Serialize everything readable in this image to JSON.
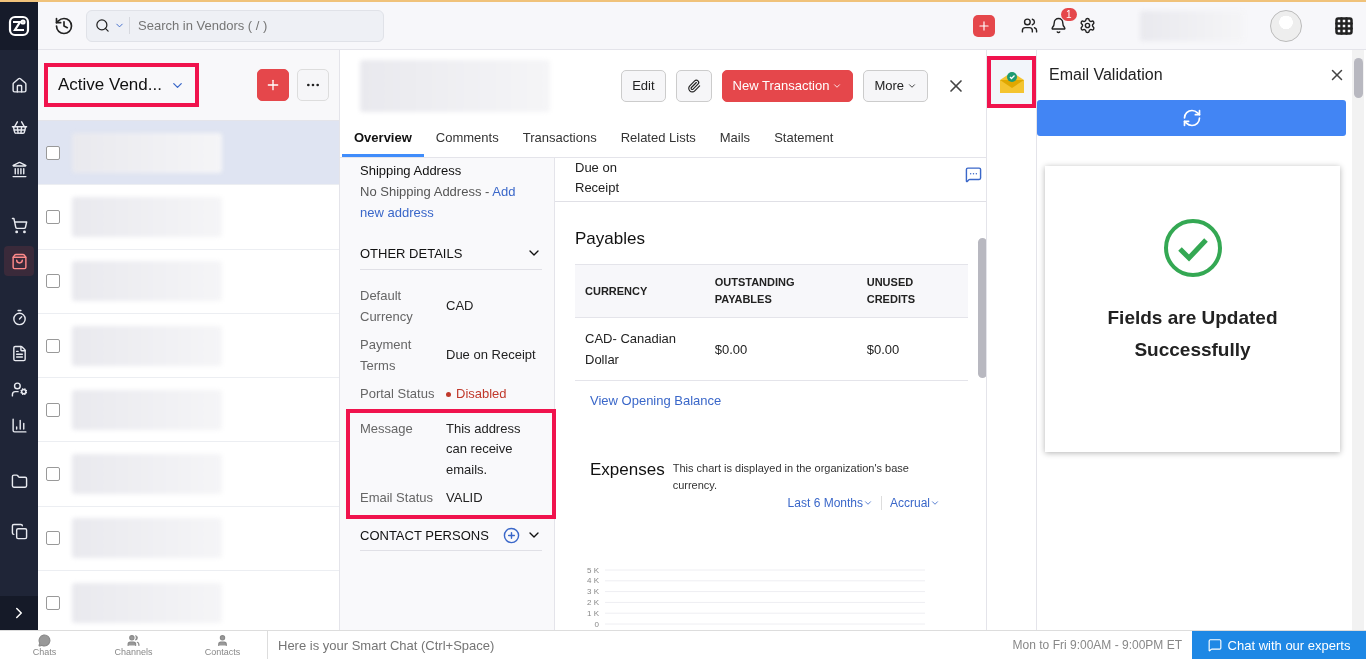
{
  "sidebar": {
    "items": [
      {
        "selected": false
      },
      {
        "selected": false
      },
      {
        "selected": false
      },
      {
        "selected": false
      },
      {
        "selected": true
      },
      {
        "selected": false
      },
      {
        "selected": false
      },
      {
        "selected": false
      },
      {
        "selected": false
      },
      {
        "selected": false
      },
      {
        "selected": false
      }
    ]
  },
  "topbar": {
    "search": {
      "placeholder": "Search in Vendors ( / )"
    },
    "notifications": "1"
  },
  "vendor_list": {
    "title": "Active Vend...",
    "highlighted": true,
    "rows": [
      {
        "checked": false,
        "selected": true
      },
      {
        "checked": false,
        "selected": false
      },
      {
        "checked": false,
        "selected": false
      },
      {
        "checked": false,
        "selected": false
      },
      {
        "checked": false,
        "selected": false
      },
      {
        "checked": false,
        "selected": false
      },
      {
        "checked": false,
        "selected": false
      },
      {
        "checked": false,
        "selected": false
      }
    ]
  },
  "detail": {
    "buttons": [
      {
        "kind": "plain",
        "label": "Edit"
      },
      {
        "kind": "attach"
      },
      {
        "kind": "primary",
        "label": "New Transaction"
      },
      {
        "kind": "menu",
        "label": "More"
      }
    ],
    "tabs": [
      {
        "label": "Overview",
        "selected": true
      },
      {
        "label": "Comments",
        "selected": false
      },
      {
        "label": "Transactions",
        "selected": false
      },
      {
        "label": "Related Lists",
        "selected": false
      },
      {
        "label": "Mails",
        "selected": false
      },
      {
        "label": "Statement",
        "selected": false
      }
    ],
    "shipping": {
      "label": "Shipping Address",
      "text": "No Shipping Address - ",
      "link": "Add new address"
    },
    "other_details": {
      "title": "OTHER DETAILS",
      "expanded": true
    },
    "fields": [
      {
        "label": "Default Currency",
        "value": "CAD",
        "kind": "text"
      },
      {
        "label": "Payment Terms",
        "value": "Due on Receipt",
        "kind": "text"
      },
      {
        "label": "Portal Status",
        "value": "Disabled",
        "kind": "status",
        "color": "#c0392b"
      }
    ],
    "highlighted_fields": [
      {
        "label": "Message",
        "value": "This address can receive emails."
      },
      {
        "label": "Email Status",
        "value": "VALID"
      }
    ],
    "contact_persons": {
      "title": "CONTACT PERSONS",
      "expanded": false
    },
    "top_value": "Due on Receipt",
    "payables": {
      "title": "Payables",
      "columns": [
        "CURRENCY",
        "OUTSTANDING PAYABLES",
        "UNUSED CREDITS"
      ],
      "rows": [
        [
          "CAD- Canadian Dollar",
          "$0.00",
          "$0.00"
        ]
      ],
      "link": "View Opening Balance"
    },
    "expenses": {
      "title": "Expenses",
      "note": "This chart is displayed in the organization's base currency.",
      "filters": [
        "Last 6 Months",
        "Accrual"
      ],
      "axis_labels": [
        "5 K",
        "4 K",
        "3 K",
        "2 K",
        "1 K",
        "0"
      ]
    }
  },
  "extension": {
    "highlighted": true
  },
  "email_validation": {
    "title": "Email Validation",
    "message": "Fields are Updated Successfully"
  },
  "bottom_bar": {
    "tabs": [
      "Chats",
      "Channels",
      "Contacts"
    ],
    "smart_chat": {
      "placeholder": "Here is your Smart Chat (Ctrl+Space)"
    },
    "hours": "Mon to Fri 9:00AM - 9:00PM ET",
    "chat_button": "Chat with our experts"
  }
}
